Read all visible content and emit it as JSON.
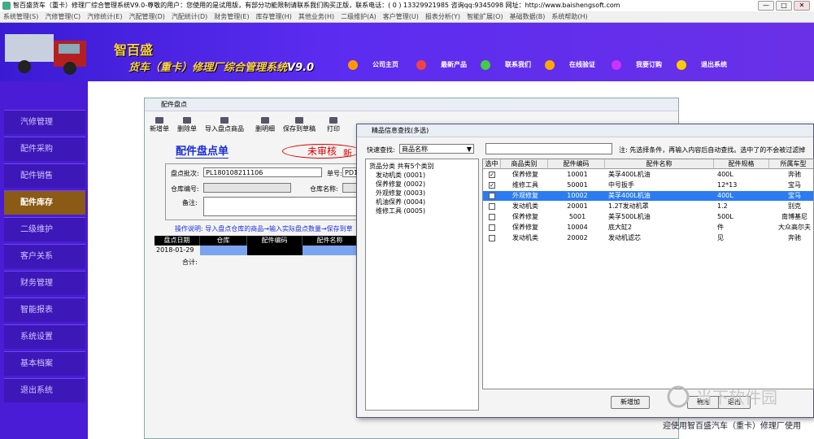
{
  "window": {
    "title": "智百盛货车（重卡）修理厂综合管理系统V9.0-尊敬的用户：您使用的是试用版，有部分功能限制请联系我们购买正版，联系电话：( 0 ) 13329921985  咨询qq:9345098   网址：http://www.baishengsoft.com",
    "btn_min": "—",
    "btn_max": "□",
    "btn_close": "✕"
  },
  "menu": [
    "系统管理(S)",
    "汽修管理(C)",
    "汽修统计(E)",
    "汽配管理(D)",
    "汽配统计(D)",
    "财务管理(E)",
    "库存管理(H)",
    "其他业务(H)",
    "二级维护(A)",
    "客户管理(U)",
    "报表分析(Y)",
    "智能扩展(O)",
    "基础数据(B)",
    "系统帮助(H)"
  ],
  "banner": {
    "logo": "智百盛",
    "title_a": "货车（重卡）修理厂综合管理系统",
    "title_b": "V9.0",
    "links": [
      "公司主页",
      "最新产品",
      "联系我们",
      "在线验证",
      "我要订购",
      "退出系统"
    ]
  },
  "sidebar": [
    "汽修管理",
    "配件采购",
    "配件销售",
    "配件库存",
    "二级维护",
    "客户关系",
    "财务管理",
    "智能报表",
    "系统设置",
    "基本档案",
    "退出系统"
  ],
  "dlg1": {
    "title": "配件盘点",
    "toolbar": [
      "新增单",
      "删除单",
      "导入盘点商品",
      "删明细",
      "保存到草稿",
      "打印"
    ],
    "doc_title": "配件盘点单",
    "status": "未审核",
    "new_lbl": "新",
    "batch_lbl": "盘点批次:",
    "batch_val": "PL180108211106",
    "no_lbl": "单号:",
    "no_val": "PD1",
    "wh_code_lbl": "仓库编号:",
    "wh_name_lbl": "仓库名称:",
    "remark_lbl": "备注:",
    "instructions": "操作说明: 导入盘点仓库的商品→输入实际盘点数量→保存到草",
    "cols": [
      "盘点日期",
      "仓库",
      "配件编码",
      "配件名称"
    ],
    "row_date": "2018-01-29",
    "total_lbl": "合计:"
  },
  "dlg2": {
    "title": "精品信息查找(多选)",
    "quick_lbl": "快速查找:",
    "quick_sel": "商品名称",
    "note": "注: 先选择条件，再输入内容后自动查找。选中了的不会被过滤掉",
    "tree_root": "货品分类  共有5个类别",
    "tree": [
      "发动机类  (0001)",
      "保养修复  (0002)",
      "外观修复  (0003)",
      "机油保养  (0004)",
      "维修工具  (0005)"
    ],
    "cols": [
      "选中",
      "商品类别",
      "配件编码",
      "配件名称",
      "配件规格",
      "所属车型"
    ],
    "rows": [
      {
        "chk": "✓",
        "cat": "保养修复",
        "code": "10001",
        "name": "美孚400L机油",
        "spec": "400L",
        "model": "奔驰"
      },
      {
        "chk": "✓",
        "cat": "维修工具",
        "code": "50001",
        "name": "中号扳手",
        "spec": "12*13",
        "model": "宝马"
      },
      {
        "chk": "✓",
        "cat": "外观修复",
        "code": "10002",
        "name": "美孚400L机油",
        "spec": "400L",
        "model": "宝马"
      },
      {
        "chk": "",
        "cat": "发动机类",
        "code": "20001",
        "name": "1.2T发动机罩",
        "spec": "1.2",
        "model": "别克"
      },
      {
        "chk": "",
        "cat": "保养修复",
        "code": "5001",
        "name": "美孚500L机油",
        "spec": "500L",
        "model": "南博基尼"
      },
      {
        "chk": "",
        "cat": "保养修复",
        "code": "10004",
        "name": "底大缸2",
        "spec": "件",
        "model": "大众高尔夫"
      },
      {
        "chk": "",
        "cat": "发动机类",
        "code": "20002",
        "name": "发动机滤芯",
        "spec": "见",
        "model": "奔驰"
      }
    ],
    "btn_add": "新增加",
    "btn_ok": "确定",
    "btn_exit": "退出"
  },
  "watermark": "当下软件园",
  "footer": "迎使用智百盛汽车（重卡）修理厂使用"
}
